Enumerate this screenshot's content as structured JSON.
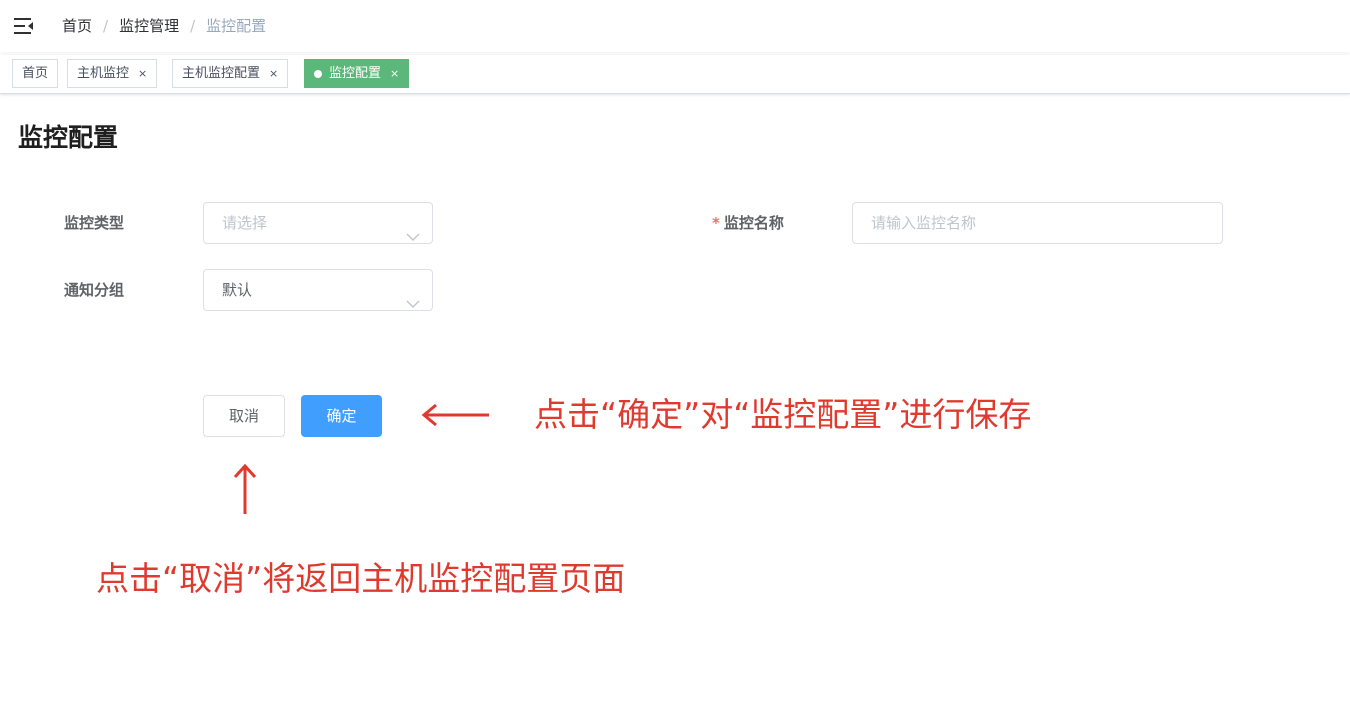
{
  "breadcrumb": {
    "items": [
      "首页",
      "监控管理",
      "监控配置"
    ],
    "separator": "/"
  },
  "tabs": [
    {
      "label": "首页",
      "closable": false,
      "active": false
    },
    {
      "label": "主机监控",
      "close": "×",
      "active": false
    },
    {
      "label": "主机监控配置",
      "close": "×",
      "active": false
    },
    {
      "label": "监控配置",
      "close": "×",
      "active": true
    }
  ],
  "page": {
    "title": "监控配置"
  },
  "form": {
    "monitor_type": {
      "label": "监控类型",
      "placeholder": "请选择"
    },
    "monitor_name": {
      "required_mark": "*",
      "label": "监控名称",
      "placeholder": "请输入监控名称"
    },
    "notify_group": {
      "label": "通知分组",
      "value": "默认"
    }
  },
  "buttons": {
    "cancel": "取消",
    "confirm": "确定"
  },
  "annotations": {
    "confirm_hint": "点击“确定”对“监控配置”进行保存",
    "cancel_hint": "点击“取消”将返回主机监控配置页面"
  },
  "colors": {
    "primary": "#409eff",
    "active_tab": "#5cb87a",
    "annotation": "#e03a2f",
    "required": "#f56c6c"
  },
  "icons": {
    "menu": "hamburger-icon",
    "dropdown": "chevron-down-icon",
    "close": "close-icon"
  }
}
